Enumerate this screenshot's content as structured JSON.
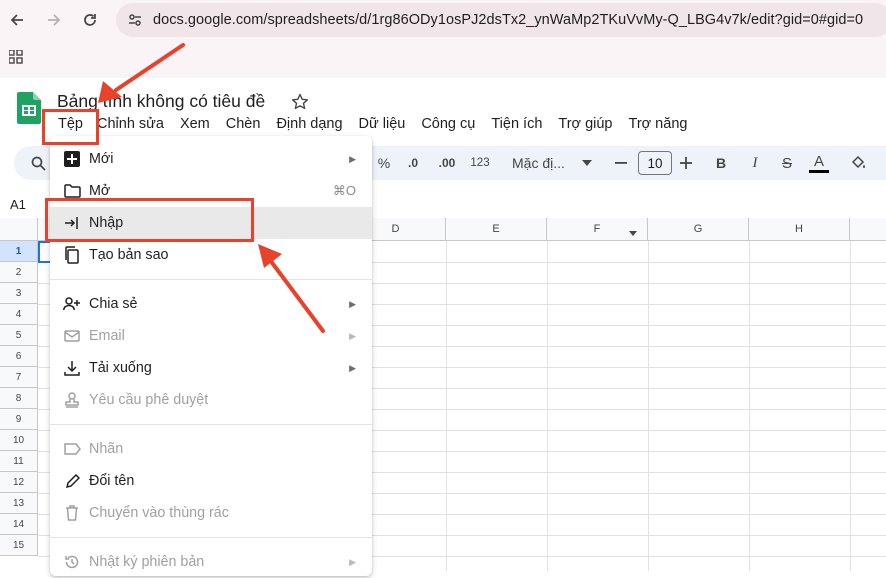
{
  "browser": {
    "url": "docs.google.com/spreadsheets/d/1rg86ODy1osPJ2dsTx2_ynWaMp2TKuVvMy-Q_LBG4v7k/edit?gid=0#gid=0"
  },
  "sheet": {
    "title": "Bảng tính không có tiêu đề",
    "menubar": [
      "Tệp",
      "Chỉnh sửa",
      "Xem",
      "Chèn",
      "Định dạng",
      "Dữ liệu",
      "Công cụ",
      "Tiện ích",
      "Trợ giúp",
      "Trợ năng"
    ],
    "toolbar": {
      "percent": "%",
      "decimal_decrease": ".0",
      "decimal_increase": ".00",
      "number_format": "123",
      "font": "Mặc đị...",
      "font_size": "10",
      "bold": "B",
      "italic": "I",
      "strike": "S",
      "text_color": "A"
    },
    "name_box": "A1",
    "columns": [
      "D",
      "E",
      "F",
      "G",
      "H"
    ],
    "rows": [
      "1",
      "2",
      "3",
      "4",
      "5",
      "6",
      "7",
      "8",
      "9",
      "10",
      "11",
      "12",
      "13",
      "14",
      "15"
    ]
  },
  "file_menu": {
    "items": [
      {
        "label": "Mới",
        "icon": "new-sheet-icon",
        "submenu": true,
        "disabled": false
      },
      {
        "label": "Mở",
        "icon": "folder-icon",
        "shortcut": "⌘O",
        "disabled": false
      },
      {
        "label": "Nhập",
        "icon": "import-icon",
        "disabled": false,
        "highlighted": true
      },
      {
        "label": "Tạo bản sao",
        "icon": "copy-icon",
        "disabled": false
      },
      {
        "label": "Chia sẻ",
        "icon": "share-person-icon",
        "submenu": true,
        "disabled": false
      },
      {
        "label": "Email",
        "icon": "email-icon",
        "submenu": true,
        "disabled": true
      },
      {
        "label": "Tải xuống",
        "icon": "download-icon",
        "submenu": true,
        "disabled": false
      },
      {
        "label": "Yêu cầu phê duyệt",
        "icon": "approval-stamp-icon",
        "disabled": true
      },
      {
        "label": "Nhãn",
        "icon": "label-tag-icon",
        "disabled": true
      },
      {
        "label": "Đổi tên",
        "icon": "pencil-icon",
        "disabled": false
      },
      {
        "label": "Chuyển vào thùng rác",
        "icon": "trash-icon",
        "disabled": true
      },
      {
        "label": "Nhật ký phiên bản",
        "icon": "history-icon",
        "submenu": true,
        "disabled": true
      }
    ]
  },
  "colors": {
    "annotation_red": "#e8412c",
    "sheets_green": "#1ea362",
    "menu_highlight": "#e9e9e9"
  }
}
